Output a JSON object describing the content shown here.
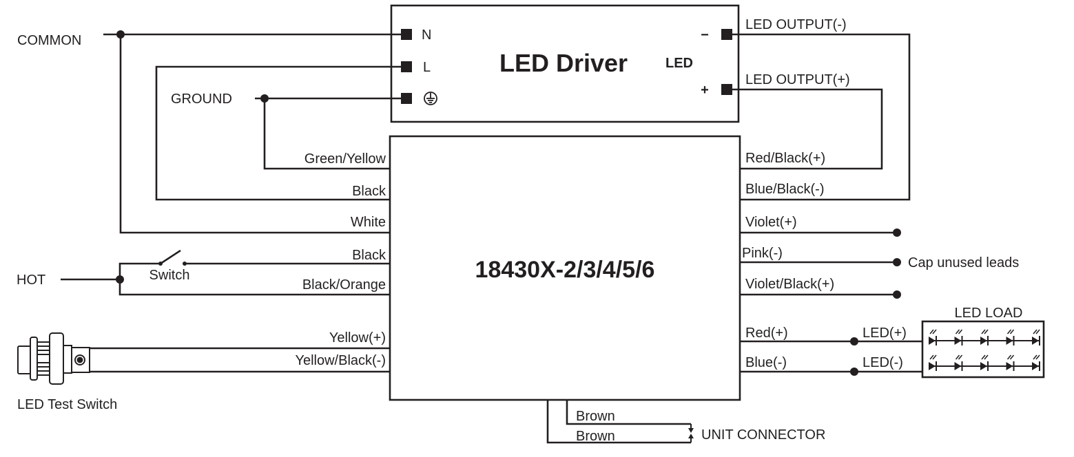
{
  "driver": {
    "title": "LED Driver",
    "led_label": "LED",
    "terminal_n": "N",
    "terminal_l": "L",
    "minus": "−",
    "plus": "+"
  },
  "unit": {
    "model": "18430X-2/3/4/5/6"
  },
  "left": {
    "common": "COMMON",
    "ground": "GROUND",
    "hot": "HOT",
    "switch": "Switch",
    "test_switch": "LED Test Switch"
  },
  "wires_left": [
    "Green/Yellow",
    "Black",
    "White",
    "Black",
    "Black/Orange",
    "Yellow(+)",
    "Yellow/Black(-)"
  ],
  "wires_right": [
    "Red/Black(+)",
    "Blue/Black(-)",
    "Violet(+)",
    "Pink(-)",
    "Violet/Black(+)",
    "Red(+)",
    "Blue(-)"
  ],
  "right": {
    "out_minus": "LED OUTPUT(-)",
    "out_plus": "LED OUTPUT(+)",
    "cap": "Cap unused leads",
    "led_plus": "LED(+)",
    "led_minus": "LED(-)",
    "load": "LED LOAD"
  },
  "bottom": {
    "wire1": "Brown",
    "wire2": "Brown",
    "connector": "UNIT CONNECTOR"
  }
}
